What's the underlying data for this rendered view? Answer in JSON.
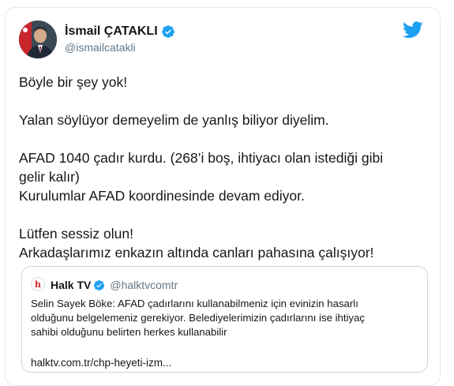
{
  "author": {
    "display_name": "İsmail ÇATAKLI",
    "handle": "@ismailcatakli"
  },
  "tweet": {
    "lines": [
      "Böyle bir şey yok!",
      "",
      "Yalan söylüyor demeyelim de yanlış biliyor diyelim.",
      "",
      "AFAD 1040 çadır kurdu. (268’i boş, ihtiyacı olan istediği gibi",
      "gelir kalır)",
      "Kurulumlar AFAD koordinesinde devam ediyor.",
      "",
      "Lütfen sessiz olun!",
      "Arkadaşlarımız enkazın altında canları pahasına çalışıyor!"
    ]
  },
  "quoted_tweet": {
    "logo_letter": "h",
    "display_name": "Halk TV",
    "handle": "@halktvcomtr",
    "lines": [
      "Selin Sayek Böke: AFAD çadırlarını kullanabilmeniz için evinizin hasarlı",
      "olduğunu belgelemeniz gerekiyor. Belediyelerimizin çadırlarını ise ihtiyaç",
      "sahibi olduğunu belirten herkes kullanabilir"
    ],
    "link": "halktv.com.tr/chp-heyeti-izm..."
  },
  "icons": {
    "verified": "verified-badge-icon",
    "brand": "twitter-bird-icon"
  },
  "colors": {
    "verified": "#1da1f2",
    "brand": "#1da1f2",
    "handle": "#657786",
    "halk_red": "#d7282f"
  }
}
